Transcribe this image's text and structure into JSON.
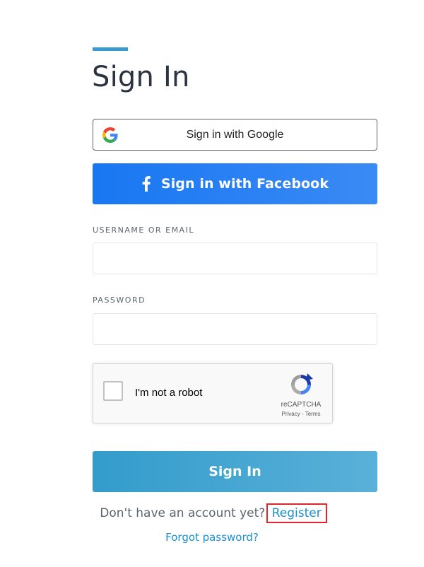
{
  "page": {
    "title": "Sign In"
  },
  "social": {
    "google_label": "Sign in with Google",
    "facebook_label": "Sign in with Facebook"
  },
  "form": {
    "username_label": "USERNAME OR EMAIL",
    "username_value": "",
    "password_label": "PASSWORD",
    "password_value": ""
  },
  "recaptcha": {
    "label": "I'm not a robot",
    "brand": "reCAPTCHA",
    "privacy": "Privacy",
    "separator": " - ",
    "terms": "Terms"
  },
  "actions": {
    "submit_label": "Sign In",
    "register_prompt": "Don't have an account yet? ",
    "register_link": "Register",
    "forgot_link": "Forgot password?"
  },
  "colors": {
    "accent": "#3a9bd1",
    "facebook": "#1877f2",
    "link": "#1a8fd0",
    "highlight": "#e0262b"
  },
  "icons": {
    "google": "google-g-icon",
    "facebook": "facebook-f-icon",
    "recaptcha": "recaptcha-logo-icon"
  }
}
